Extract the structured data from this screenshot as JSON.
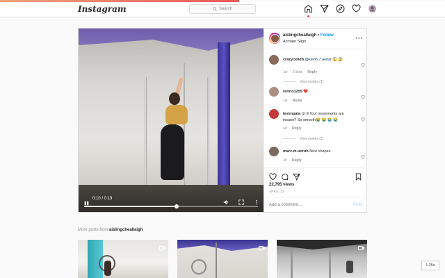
{
  "nav": {
    "logo": "Instagram",
    "search_placeholder": "Search",
    "icons": [
      "home-icon",
      "direct-icon",
      "explore-icon",
      "activity-heart-icon",
      "profile-avatar-icon"
    ]
  },
  "post": {
    "username": "aislingcheallaigh",
    "separator": " • ",
    "follow_label": "Follow",
    "location": "Acroaer Sligo",
    "video": {
      "time": "0:10 / 0:19",
      "progress": 0.53
    },
    "comments": [
      {
        "user": "crazycelidh",
        "text": "@kevin.7.aerial 😱 😱",
        "mention": "@kevin.7.aerial",
        "rest": " 😱 😱",
        "age": "1w",
        "likes": "2 likes",
        "reply": "Reply",
        "view_replies": "View replies (1)"
      },
      {
        "user": "rerino1255",
        "text": "❤️",
        "age": "1w",
        "reply": "Reply"
      },
      {
        "user": "leximpala",
        "text": "Ur lil foot movements are insane!! So smooth😭 😭 😭 😭",
        "age": "4d",
        "reply": "Reply",
        "view_replies": "View replies (1)"
      },
      {
        "user": "marc.m.unruh",
        "text": "Nice shapes",
        "age": "2d",
        "reply": "Reply"
      }
    ],
    "views": "22,795 views",
    "date": "APRIL 13",
    "add_comment_placeholder": "Add a comment...",
    "post_button": "Post"
  },
  "more_posts": {
    "prefix": "More posts from ",
    "username": "aislingcheallaigh"
  },
  "zoom": "1.25x",
  "colors": {
    "accent_blue": "#0095f6",
    "notification_red": "#ed4956"
  }
}
